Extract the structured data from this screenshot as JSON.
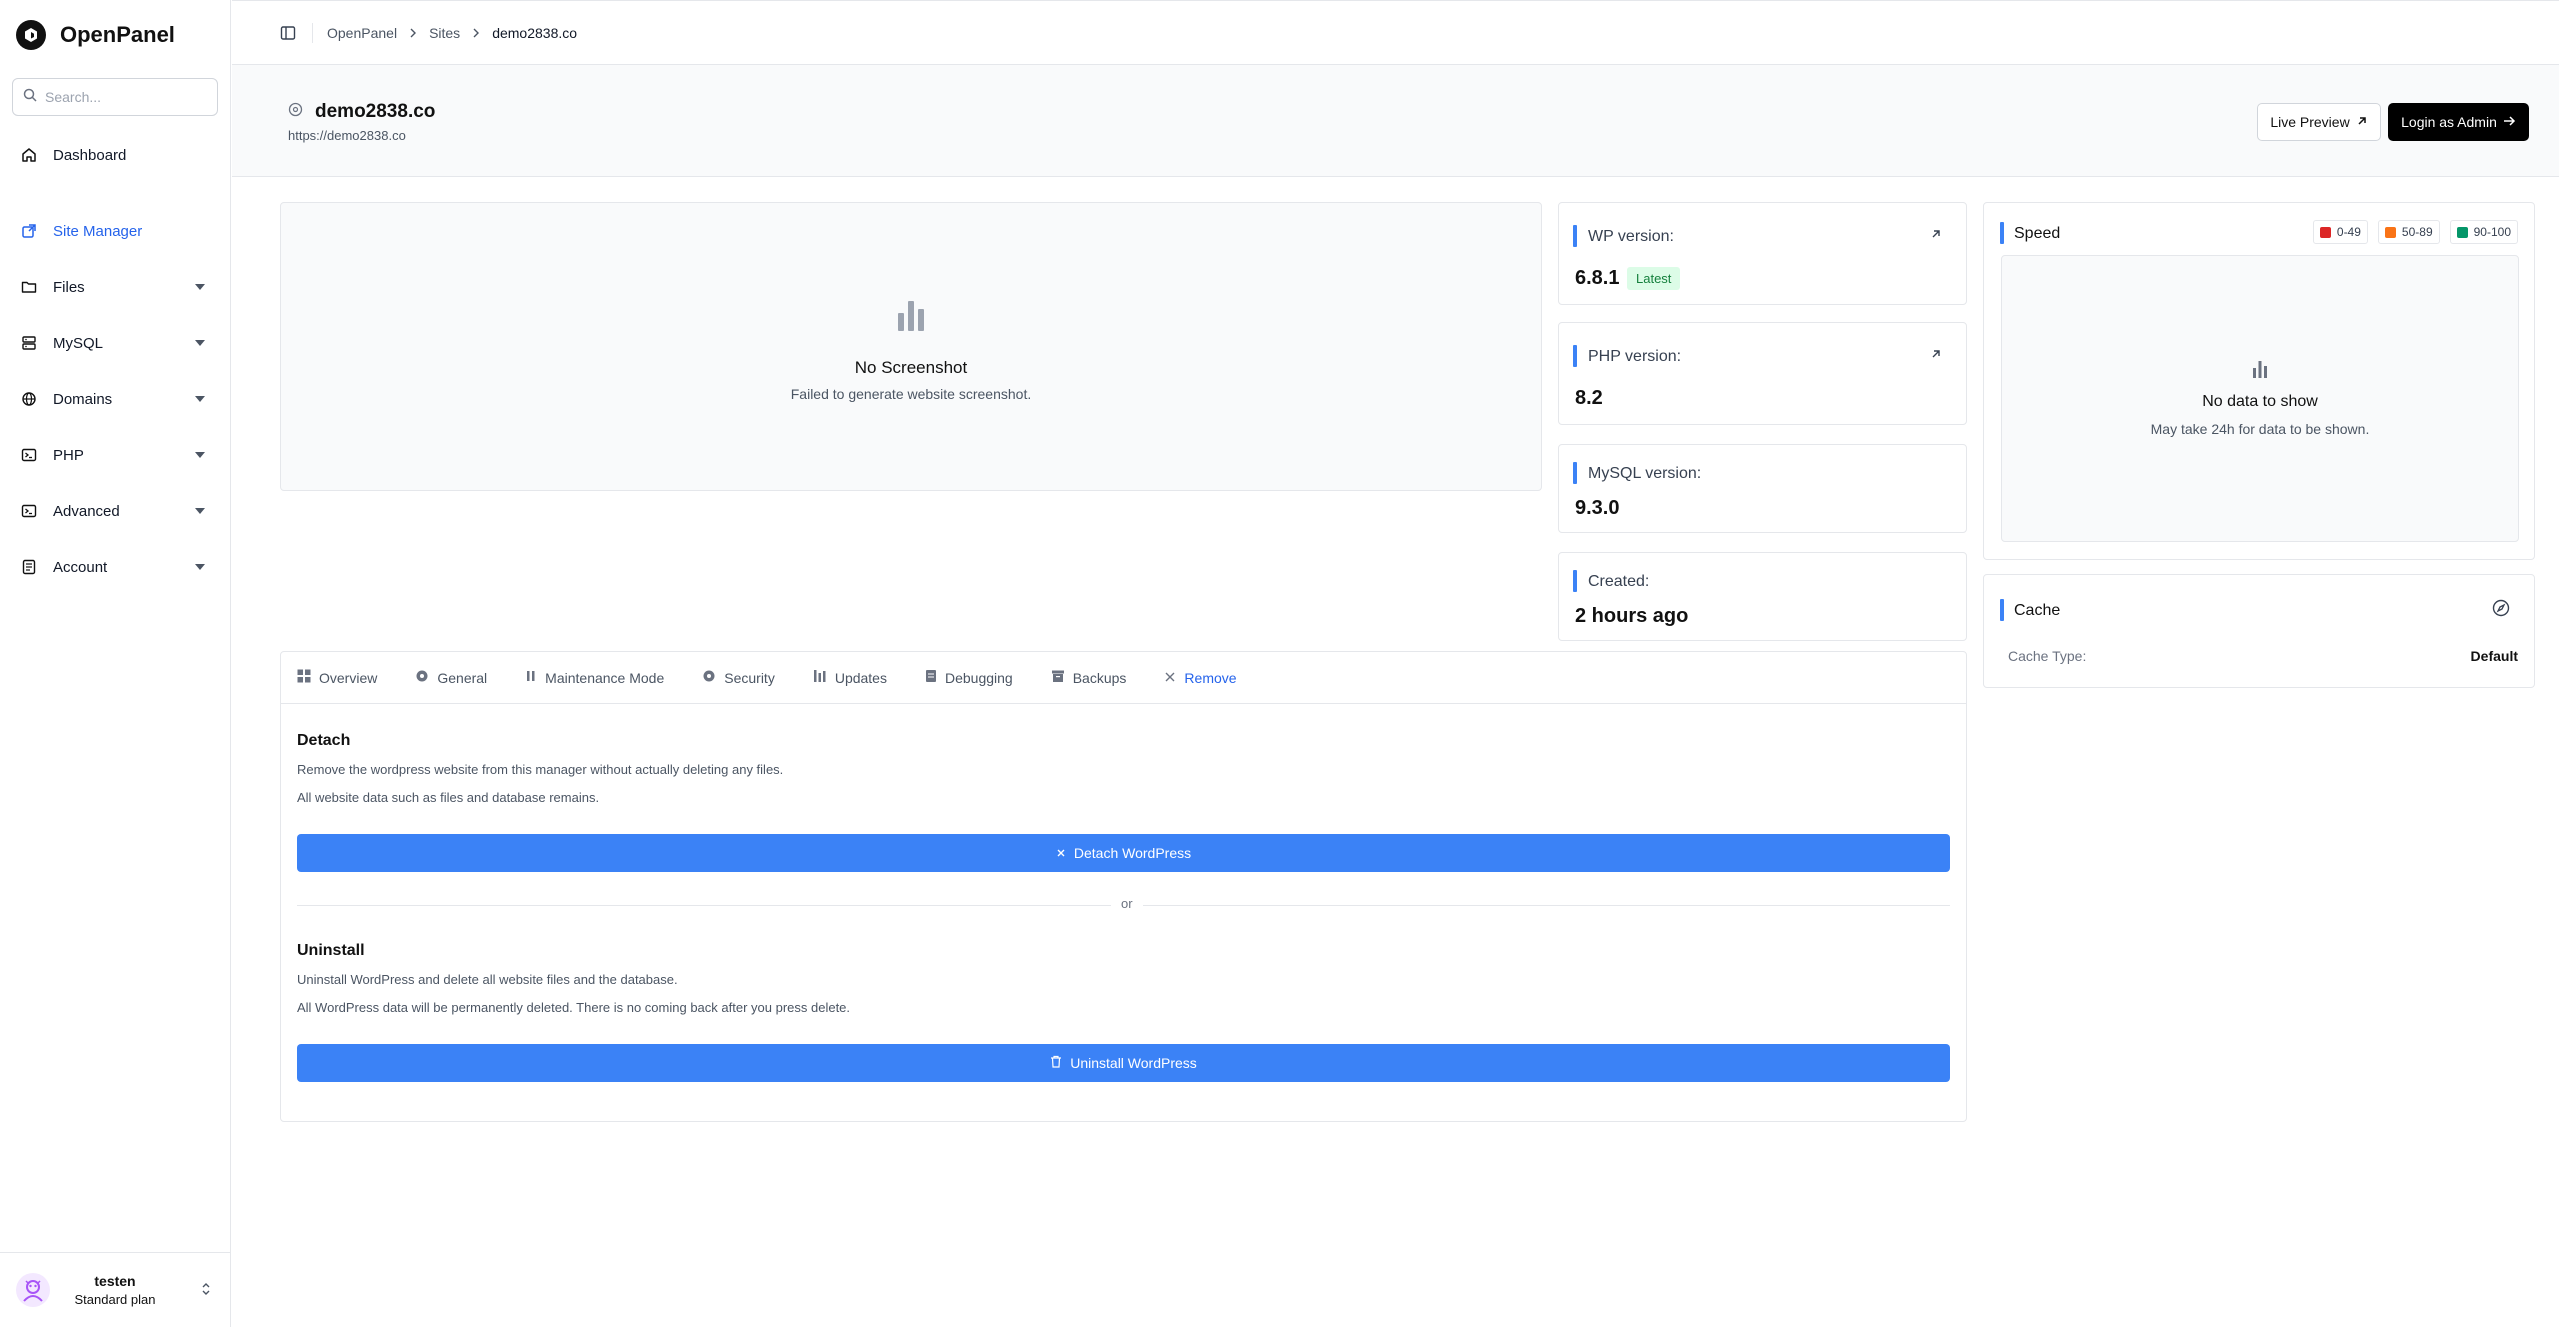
{
  "app": {
    "name": "OpenPanel"
  },
  "search": {
    "placeholder": "Search..."
  },
  "sidebar": {
    "items": [
      {
        "label": "Dashboard",
        "icon": "home-icon"
      },
      {
        "label": "Site Manager",
        "icon": "site-manager-icon",
        "active": true
      },
      {
        "label": "Files",
        "icon": "folder-icon"
      },
      {
        "label": "MySQL",
        "icon": "database-icon"
      },
      {
        "label": "Domains",
        "icon": "globe-icon"
      },
      {
        "label": "PHP",
        "icon": "terminal-icon"
      },
      {
        "label": "Advanced",
        "icon": "terminal-icon"
      },
      {
        "label": "Account",
        "icon": "account-icon"
      }
    ]
  },
  "user": {
    "name": "testen",
    "plan": "Standard plan"
  },
  "breadcrumb": [
    "OpenPanel",
    "Sites",
    "demo2838.co"
  ],
  "site": {
    "domain": "demo2838.co",
    "url": "https://demo2838.co",
    "live_preview": "Live Preview",
    "login_admin": "Login as Admin"
  },
  "screenshot": {
    "title": "No Screenshot",
    "subtitle": "Failed to generate website screenshot."
  },
  "info": {
    "wp_label": "WP version:",
    "wp_value": "6.8.1",
    "wp_badge": "Latest",
    "php_label": "PHP version:",
    "php_value": "8.2",
    "mysql_label": "MySQL version:",
    "mysql_value": "9.3.0",
    "created_label": "Created:",
    "created_value": "2 hours ago"
  },
  "speed": {
    "title": "Speed",
    "legend": [
      {
        "label": "0-49",
        "color": "#dc2626"
      },
      {
        "label": "50-89",
        "color": "#f97316"
      },
      {
        "label": "90-100",
        "color": "#059669"
      }
    ],
    "empty_title": "No data to show",
    "empty_sub": "May take 24h for data to be shown."
  },
  "cache": {
    "title": "Cache",
    "type_label": "Cache Type:",
    "type_value": "Default"
  },
  "tabs": [
    "Overview",
    "General",
    "Maintenance Mode",
    "Security",
    "Updates",
    "Debugging",
    "Backups",
    "Remove"
  ],
  "remove": {
    "detach_title": "Detach",
    "detach_line1": "Remove the wordpress website from this manager without actually deleting any files.",
    "detach_line2": "All website data such as files and database remains.",
    "detach_button": "Detach WordPress",
    "or": "or",
    "uninstall_title": "Uninstall",
    "uninstall_line1": "Uninstall WordPress and delete all website files and the database.",
    "uninstall_line2": "All WordPress data will be permanently deleted. There is no coming back after you press delete.",
    "uninstall_button": "Uninstall WordPress"
  },
  "colors": {
    "accent": "#3b82f6",
    "active_text": "#2563eb"
  }
}
